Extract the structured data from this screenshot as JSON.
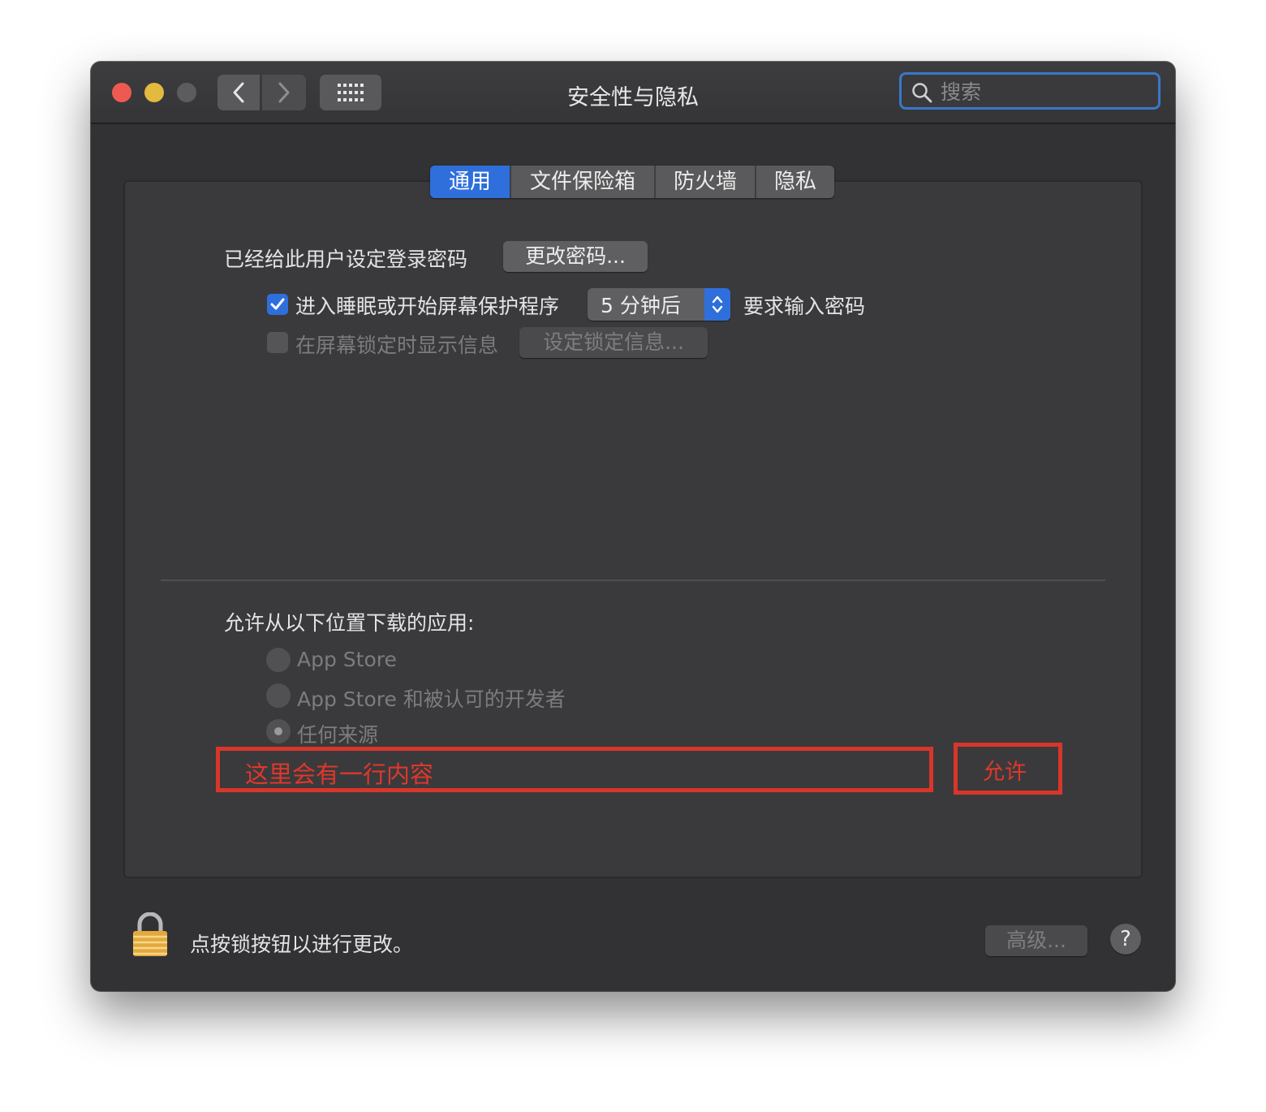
{
  "window": {
    "title": "安全性与隐私"
  },
  "search": {
    "placeholder": "搜索"
  },
  "tabs": [
    {
      "label": "通用",
      "active": true
    },
    {
      "label": "文件保险箱",
      "active": false
    },
    {
      "label": "防火墙",
      "active": false
    },
    {
      "label": "隐私",
      "active": false
    }
  ],
  "general": {
    "password_set_label": "已经给此用户设定登录密码",
    "change_password_button": "更改密码...",
    "require_password": {
      "checked": true,
      "label_before": "进入睡眠或开始屏幕保护程序",
      "delay_value": "5 分钟后",
      "label_after": "要求输入密码"
    },
    "show_message": {
      "checked": false,
      "label": "在屏幕锁定时显示信息",
      "set_message_button": "设定锁定信息..."
    },
    "allow_apps_label": "允许从以下位置下载的应用:",
    "sources": [
      {
        "label": "App Store",
        "selected": false
      },
      {
        "label": "App Store 和被认可的开发者",
        "selected": false
      },
      {
        "label": "任何来源",
        "selected": true
      }
    ],
    "annotation": {
      "placeholder_text": "这里会有一行内容",
      "allow_text": "允许",
      "color": "#d9362b"
    }
  },
  "footer": {
    "lock_text": "点按锁按钮以进行更改。",
    "advanced_button": "高级...",
    "help_button": "?"
  },
  "colors": {
    "accent": "#2f6fdc",
    "close": "#ee5a52",
    "minimize": "#e4b940",
    "zoom_disabled": "#5c5c5e"
  }
}
